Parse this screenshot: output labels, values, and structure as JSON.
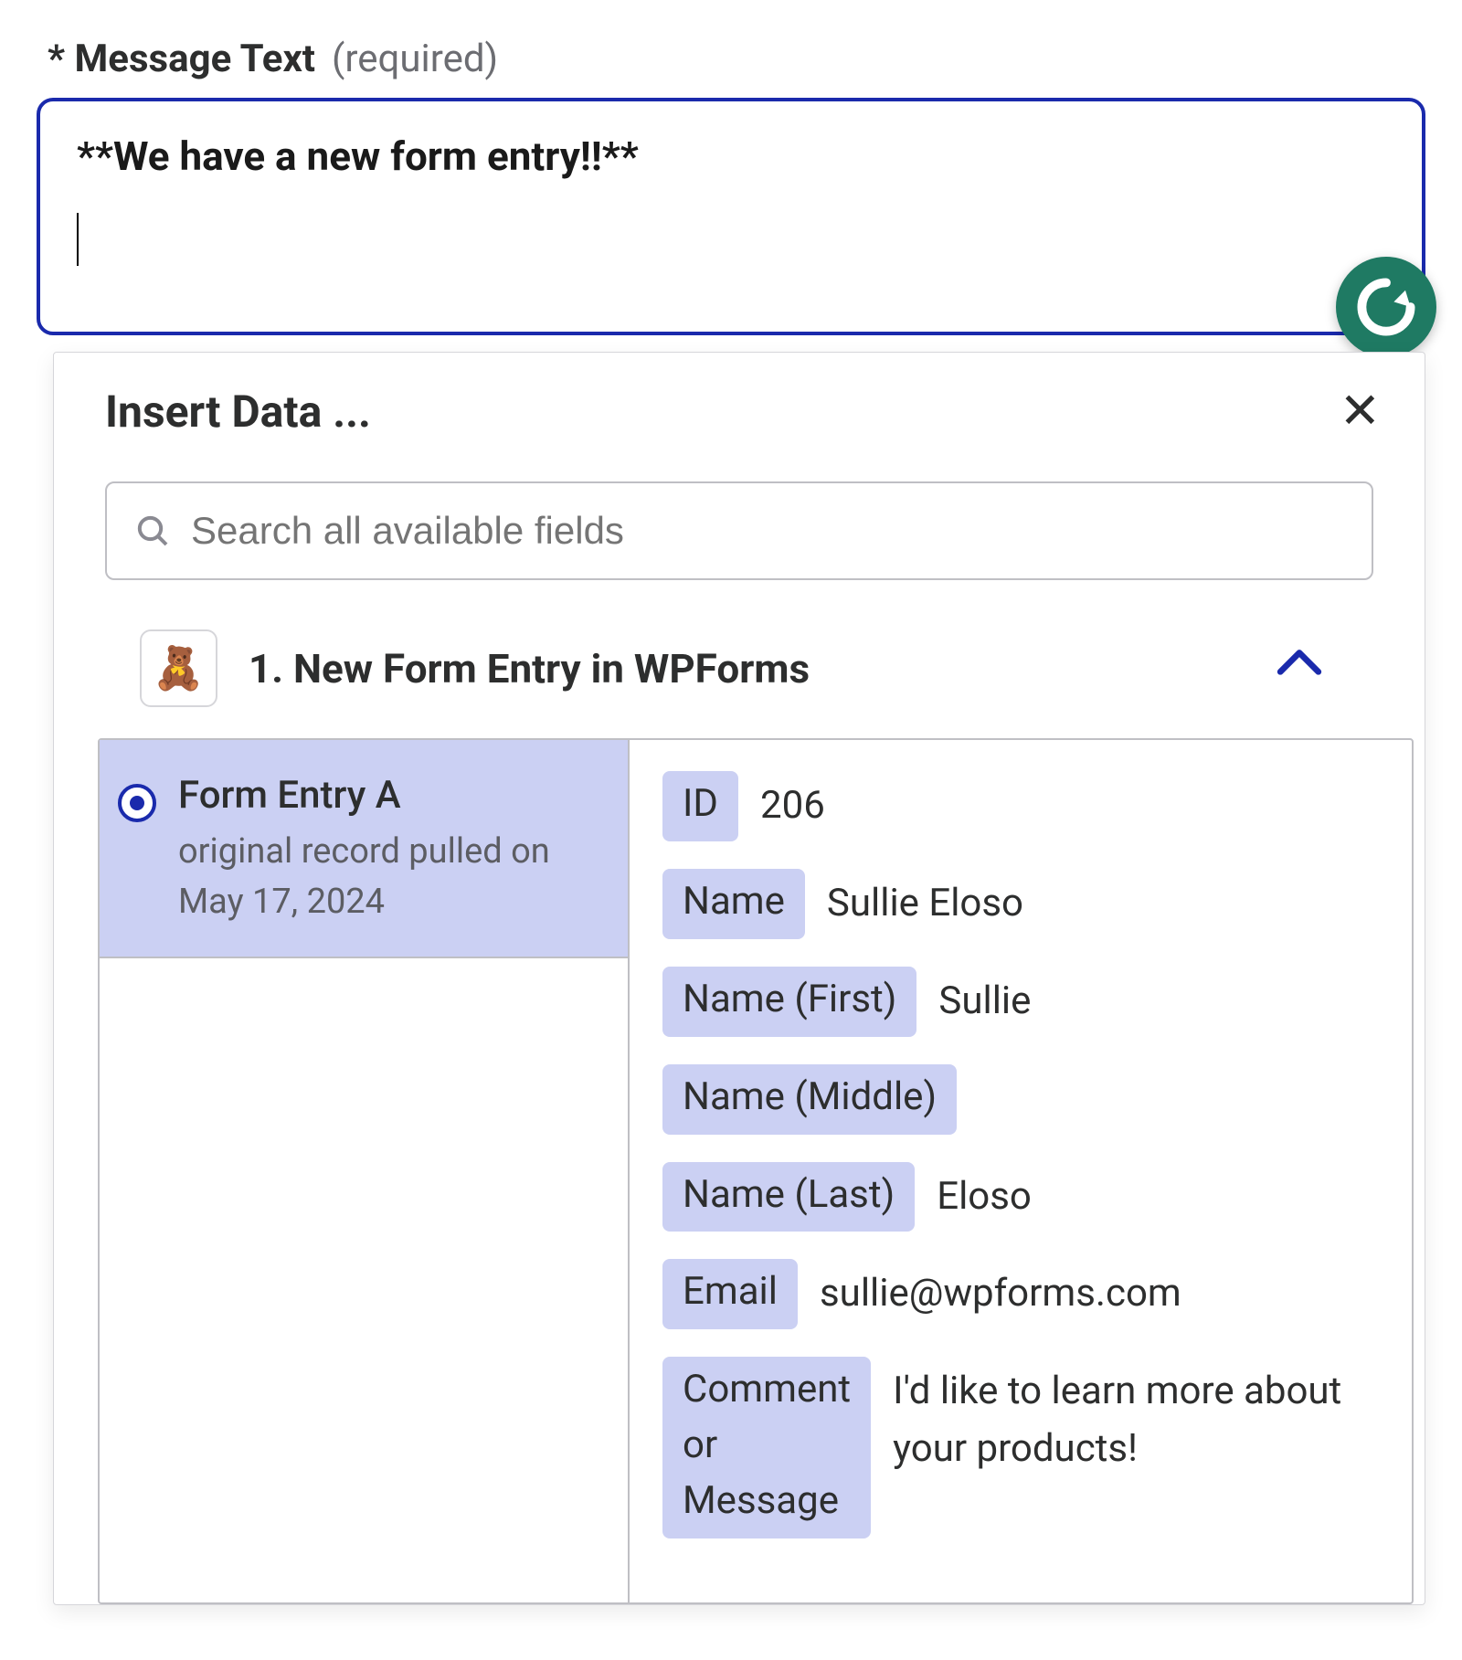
{
  "label": {
    "asterisk": "*",
    "text": "Message Text",
    "required": "(required)"
  },
  "textarea": {
    "value": "**We have a new form entry!!**"
  },
  "dropdown": {
    "title": "Insert Data ...",
    "search_placeholder": "Search all available fields",
    "step": {
      "icon": "🧸",
      "title": "1. New Form Entry in WPForms"
    },
    "record": {
      "title": "Form Entry A",
      "subtitle_line1": "original record pulled on",
      "subtitle_line2": "May 17, 2024"
    },
    "fields": [
      {
        "label": "ID",
        "value": "206"
      },
      {
        "label": "Name",
        "value": "Sullie Eloso"
      },
      {
        "label": "Name (First)",
        "value": "Sullie"
      },
      {
        "label": "Name (Middle)",
        "value": ""
      },
      {
        "label": "Name (Last)",
        "value": "Eloso"
      },
      {
        "label": "Email",
        "value": "sullie@wpforms.com"
      },
      {
        "label": "Comment or Message",
        "value": "I'd like to learn more about your products!"
      }
    ]
  }
}
